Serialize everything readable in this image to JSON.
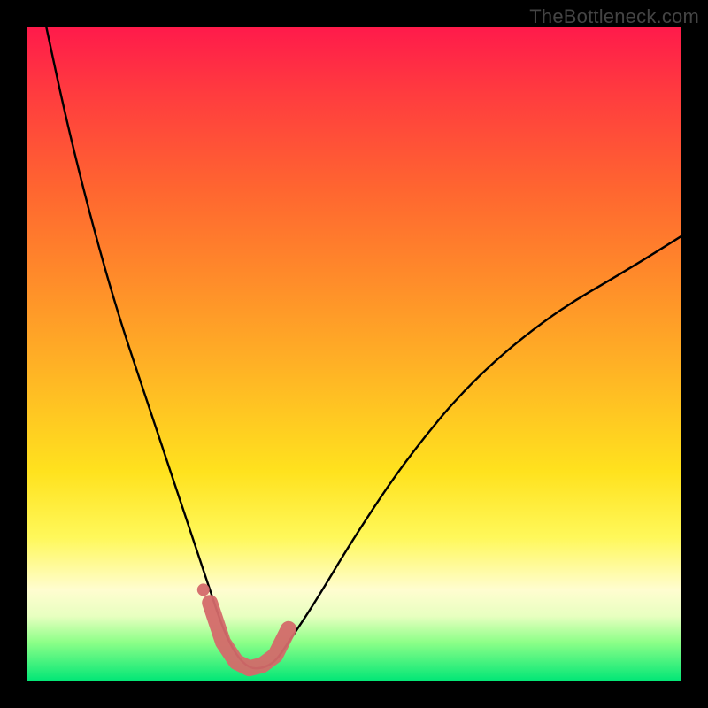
{
  "watermark": "TheBottleneck.com",
  "chart_data": {
    "type": "line",
    "title": "",
    "xlabel": "",
    "ylabel": "",
    "xlim": [
      0,
      100
    ],
    "ylim": [
      0,
      100
    ],
    "series": [
      {
        "name": "bottleneck-curve",
        "x": [
          3,
          6,
          10,
          14,
          18,
          22,
          26,
          28,
          30,
          32,
          34,
          36,
          38,
          40,
          44,
          50,
          58,
          68,
          80,
          92,
          100
        ],
        "values": [
          100,
          86,
          70,
          56,
          44,
          32,
          20,
          14,
          8,
          4,
          2,
          2,
          3,
          6,
          12,
          22,
          34,
          46,
          56,
          63,
          68
        ]
      }
    ],
    "highlight_segment": {
      "name": "valley-marker",
      "x": [
        28,
        30,
        32,
        34,
        36,
        38,
        40
      ],
      "values": [
        12,
        6,
        3,
        2,
        2.5,
        4,
        8
      ]
    },
    "highlight_dot": {
      "x": 27,
      "y": 14
    },
    "background_gradient": {
      "stops": [
        {
          "pos": 0,
          "color": "#ff1a4b"
        },
        {
          "pos": 25,
          "color": "#ff6630"
        },
        {
          "pos": 52,
          "color": "#ffb225"
        },
        {
          "pos": 78,
          "color": "#fff85a"
        },
        {
          "pos": 90,
          "color": "#e8ffc0"
        },
        {
          "pos": 100,
          "color": "#00e676"
        }
      ]
    }
  }
}
